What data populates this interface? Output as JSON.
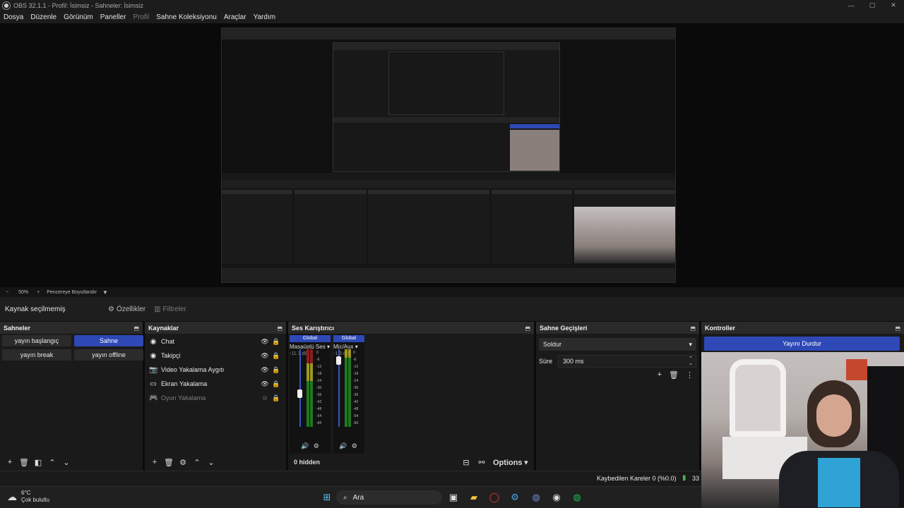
{
  "window": {
    "title": "OBS 32.1.1 - Profil: İsimsiz - Sahneler: İsimsiz",
    "minimize": "—",
    "maximize": "▢",
    "close": "✕"
  },
  "menu": {
    "items": [
      "Dosya",
      "Düzenle",
      "Görünüm",
      "Paneller",
      "Profil",
      "Sahne Koleksiyonu",
      "Araçlar",
      "Yardım"
    ]
  },
  "zoombar": {
    "minus": "−",
    "zoom": "50%",
    "plus": "+",
    "resize_label": "Pencereye Boyutlandır"
  },
  "source_toolbar": {
    "no_selection": "Kaynak seçilmemiş",
    "properties": "Özellikler",
    "filters": "Filtreler"
  },
  "scenes": {
    "title": "Sahneler",
    "items": [
      "yayın başlangıç",
      "Sahne",
      "yayın break",
      "yayın offline"
    ],
    "active": "Sahne"
  },
  "sources": {
    "title": "Kaynaklar",
    "items": [
      {
        "label": "Chat",
        "icon": "browser-icon",
        "visible": true
      },
      {
        "label": "Takipçi",
        "icon": "browser-icon",
        "visible": true
      },
      {
        "label": "Video Yakalama Aygıtı",
        "icon": "camera-icon",
        "visible": true
      },
      {
        "label": "Ekran Yakalama",
        "icon": "monitor-icon",
        "visible": true
      },
      {
        "label": "Oyun Yakalama",
        "icon": "gamepad-icon",
        "visible": false
      }
    ]
  },
  "mixer": {
    "title": "Ses Karıştırıcı",
    "channels": [
      {
        "tag": "Global",
        "name": "Masaüstü Ses",
        "db": "-11.7 dB",
        "level": 0.45
      },
      {
        "tag": "Global",
        "name": "Mic/Aux",
        "db": "-1.3 dB",
        "level": 0.9
      }
    ],
    "scale": [
      "0",
      "-6",
      "-12",
      "-18",
      "-24",
      "-30",
      "-36",
      "-42",
      "-48",
      "-54",
      "-60"
    ],
    "hidden": "0 hidden",
    "options": "Options"
  },
  "transitions": {
    "title": "Sahne Geçişleri",
    "selected": "Soldur",
    "duration_label": "Süre",
    "duration_value": "300 ms"
  },
  "controls": {
    "title": "Kontroller",
    "stop_stream": "Yayını Durdur"
  },
  "status": {
    "dropped_frames": "Kaybedilen Kareler 0 (%0.0)",
    "partial": "33"
  },
  "taskbar": {
    "temp": "6°C",
    "weather": "Çok bulutlu",
    "search": "Ara"
  }
}
